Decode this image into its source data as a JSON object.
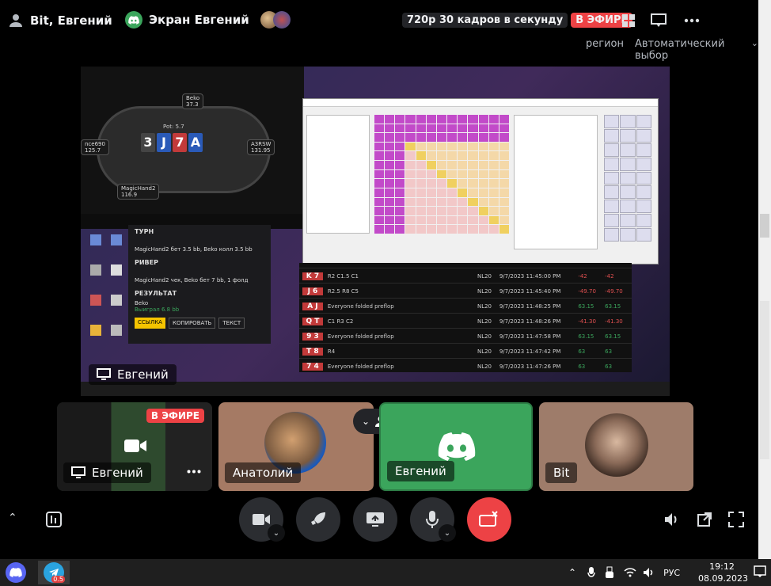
{
  "topbar": {
    "user_name": "Bit, Евгений",
    "screen_title": "Экран Евгений",
    "resolution_badge": "720p 30 кадров в секунду",
    "live_badge": "В ЭФИРЕ"
  },
  "region": {
    "label": "регион",
    "value": "Автоматический выбор"
  },
  "main_share": {
    "owner": "Евгений",
    "hand_panel": {
      "turn_label": "ТУРН",
      "turn_action": "MagicHand2 бет 3.5 bb, Beko колл 3.5 bb",
      "river_label": "РИВЕР",
      "river_action": "MagicHand2 чек, Beko бет 7 bb, 1 фолд",
      "result_label": "РЕЗУЛЬТАТ",
      "result_text": "Beko",
      "result_sub": "Выиграл 6.8 bb",
      "btn_link": "ССЫЛКА",
      "btn_copy": "КОПИРОВАТЬ",
      "btn_text": "ТЕКСТ"
    },
    "table": {
      "pot": "Pot: 5.7",
      "board": [
        "3",
        "J",
        "7",
        "A"
      ],
      "player_top": "Beko",
      "player_top_stack": "37.3",
      "player_left": "nce690",
      "player_left_stack": "125.7",
      "player_right": "A3RSW",
      "player_right_stack": "131.95",
      "player_bottom": "MagicHand2",
      "player_bottom_stack": "116.9"
    },
    "history_rows": [
      {
        "cards": "K 7",
        "text": "R2 C1.5 C1",
        "stake": "NL20",
        "date": "9/7/2023 11:45:00 PM",
        "a": "-42",
        "b": "-42"
      },
      {
        "cards": "J 6",
        "text": "R2.5 R8 C5",
        "stake": "NL20",
        "date": "9/7/2023 11:45:40 PM",
        "a": "-49.70",
        "b": "-49.70"
      },
      {
        "cards": "A J",
        "text": "Everyone folded preflop",
        "stake": "NL20",
        "date": "9/7/2023 11:48:25 PM",
        "a": "63.15",
        "b": "63.15"
      },
      {
        "cards": "Q T",
        "text": "C1 R3 C2",
        "stake": "NL20",
        "date": "9/7/2023 11:48:26 PM",
        "a": "-41.30",
        "b": "-41.30"
      },
      {
        "cards": "9 3",
        "text": "Everyone folded preflop",
        "stake": "NL20",
        "date": "9/7/2023 11:47:58 PM",
        "a": "63.15",
        "b": "63.15"
      },
      {
        "cards": "T 8",
        "text": "R4",
        "stake": "NL20",
        "date": "9/7/2023 11:47:42 PM",
        "a": "63",
        "b": "63"
      },
      {
        "cards": "7 4",
        "text": "Everyone folded preflop",
        "stake": "NL20",
        "date": "9/7/2023 11:47:26 PM",
        "a": "63",
        "b": "63"
      }
    ]
  },
  "tiles": [
    {
      "name": "Евгений",
      "type": "screen",
      "live": "В ЭФИРЕ"
    },
    {
      "name": "Анатолий",
      "type": "avatar"
    },
    {
      "name": "Евгений",
      "type": "discord"
    },
    {
      "name": "Bit",
      "type": "avatar"
    }
  ],
  "taskbar": {
    "lang": "РУС",
    "time": "19:12",
    "date": "08.09.2023",
    "telegram_badge": "0.5"
  },
  "colors": {
    "discord_green": "#3ba55c",
    "live_red": "#ed4245",
    "discord_blurple": "#5865f2"
  }
}
